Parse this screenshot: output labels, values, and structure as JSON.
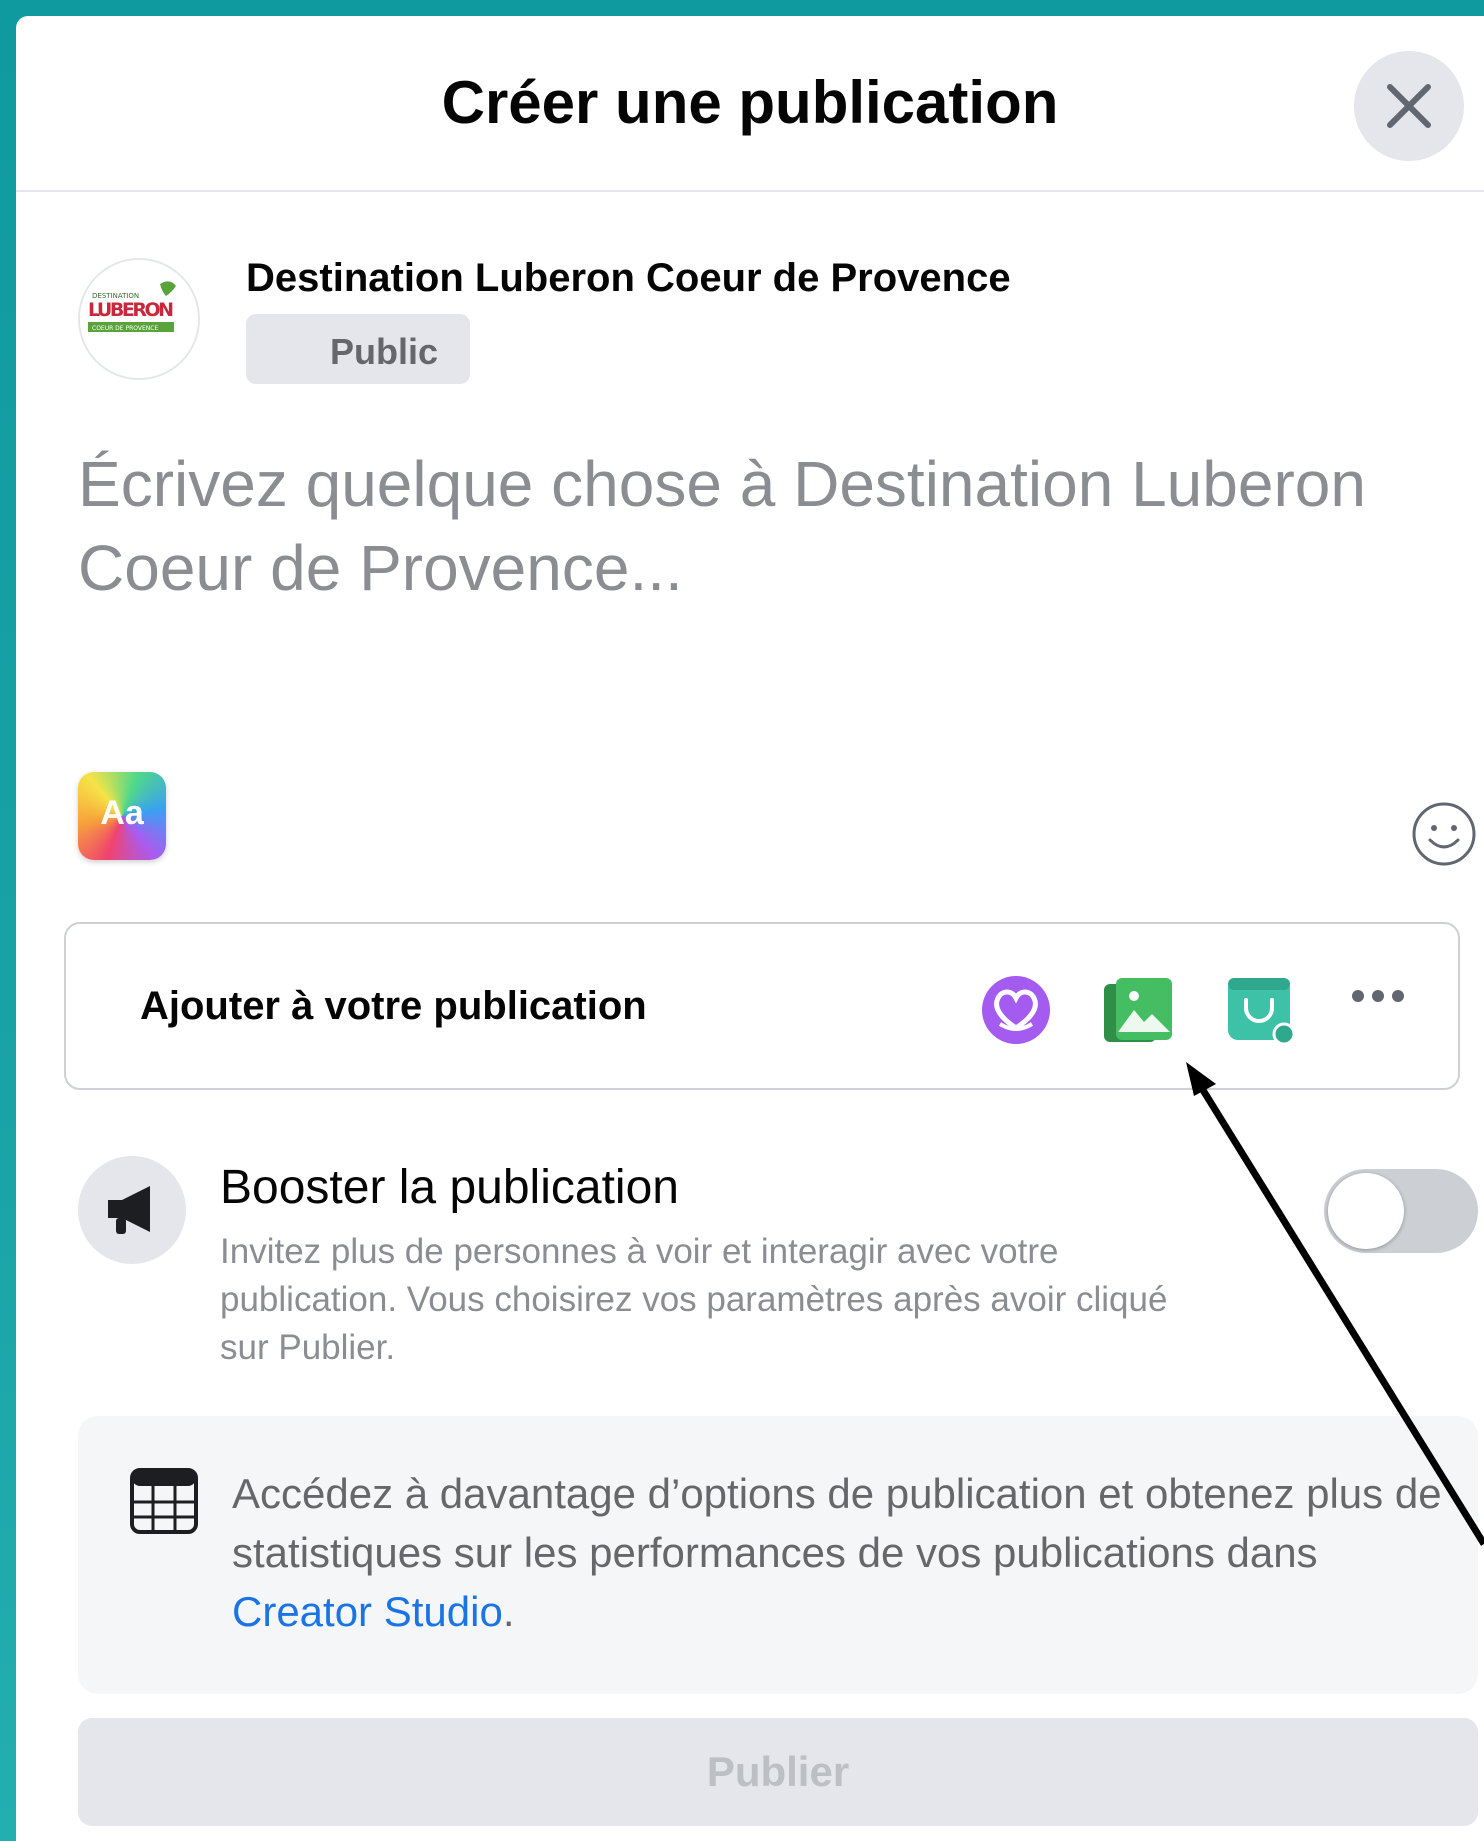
{
  "header": {
    "title": "Créer une publication",
    "close_icon": "close-icon"
  },
  "author": {
    "name": "Destination Luberon Coeur de Provence",
    "privacy": "Public",
    "avatar_logo_text": [
      "DESTINATION",
      "LUBERON",
      "COEUR DE PROVENCE"
    ]
  },
  "composer": {
    "placeholder": "Écrivez quelque chose à Destination Luberon Coeur de Provence..."
  },
  "toolbar": {
    "aa_label": "Aa",
    "emoji_icon": "emoji-icon"
  },
  "add_to_post": {
    "label": "Ajouter à votre publication",
    "icons": [
      "fundraiser-heart-icon",
      "photo-video-icon",
      "shop-bag-icon",
      "more-icon"
    ],
    "colors": {
      "heart": "#a35bf0",
      "photo": "#45bd62",
      "shop": "#3ec2a7"
    }
  },
  "boost": {
    "title": "Booster la publication",
    "description": "Invitez plus de personnes à voir et interagir avec votre publication. Vous choisirez vos paramètres après avoir cliqué sur Publier.",
    "enabled": false
  },
  "creator_studio": {
    "text_before": "Accédez à davantage d’options de publication et obtenez plus de statistiques sur les performances de vos publications dans ",
    "link": "Creator Studio",
    "text_after": "."
  },
  "publish": {
    "label": "Publier"
  },
  "colors": {
    "link": "#1b74e4",
    "button_disabled": "#e4e6eb",
    "text_secondary": "#65676b"
  }
}
